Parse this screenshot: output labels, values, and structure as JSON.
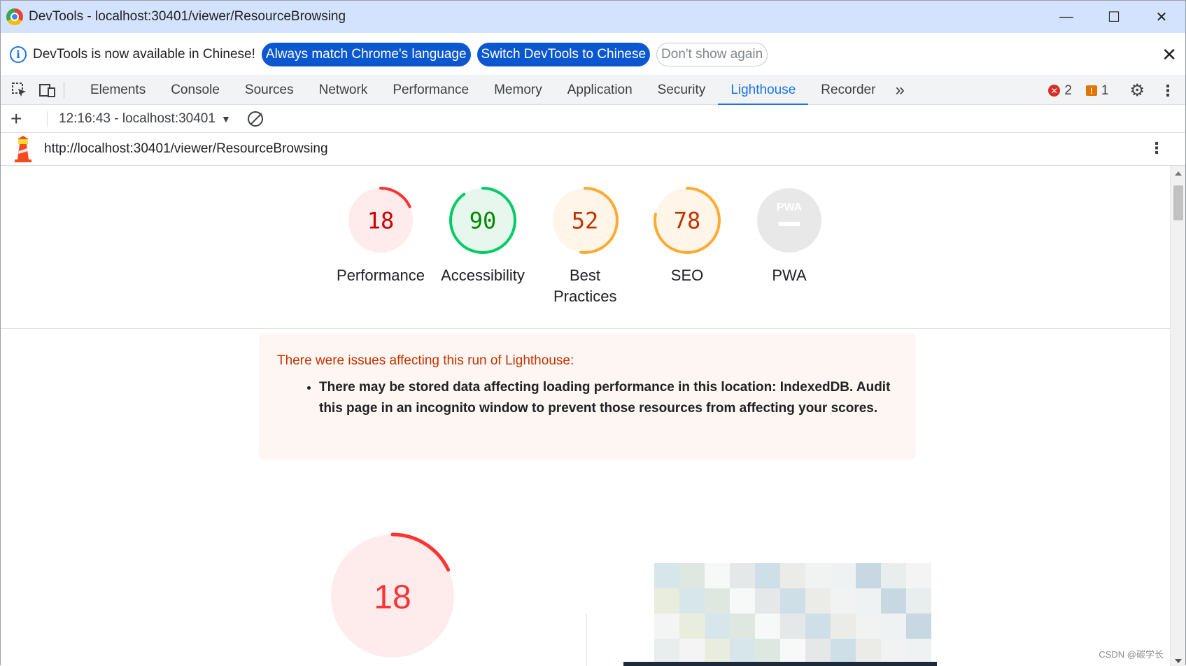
{
  "window": {
    "title": "DevTools - localhost:30401/viewer/ResourceBrowsing",
    "minimize_glyph": "—",
    "maximize_glyph": "☐",
    "close_glyph": "✕"
  },
  "infobar": {
    "message": "DevTools is now available in Chinese!",
    "btn_match": "Always match Chrome's language",
    "btn_switch": "Switch DevTools to Chinese",
    "btn_dismiss": "Don't show again",
    "close_glyph": "✕"
  },
  "tabs": {
    "items": [
      "Elements",
      "Console",
      "Sources",
      "Network",
      "Performance",
      "Memory",
      "Application",
      "Security",
      "Lighthouse",
      "Recorder"
    ],
    "active": "Lighthouse",
    "more_glyph": "»",
    "error_count": "2",
    "warning_count": "1"
  },
  "report": {
    "selected": "12:16:43 - localhost:30401",
    "url": "http://localhost:30401/viewer/ResourceBrowsing"
  },
  "scores": [
    {
      "label": "Performance",
      "value": 18,
      "display": "18",
      "color": "#f33",
      "text_color": "#c00",
      "bg": "#fdeceb"
    },
    {
      "label": "Accessibility",
      "value": 90,
      "display": "90",
      "color": "#0c6",
      "text_color": "#080",
      "bg": "#e7f7ed"
    },
    {
      "label": "Best Practices",
      "value": 52,
      "display": "52",
      "color": "#fa3",
      "text_color": "#c33300",
      "bg": "#fff5e9"
    },
    {
      "label": "SEO",
      "value": 78,
      "display": "78",
      "color": "#fa3",
      "text_color": "#c33300",
      "bg": "#fff5e9"
    },
    {
      "label": "PWA",
      "value": null,
      "display": "PWA",
      "color": "#ccc",
      "text_color": "#999",
      "bg": "#e8e8e8"
    }
  ],
  "warning": {
    "title": "There were issues affecting this run of Lighthouse:",
    "items": [
      "There may be stored data affecting loading performance in this location: IndexedDB. Audit this page in an incognito window to prevent those resources from affecting your scores."
    ]
  },
  "main_score": {
    "value": 18,
    "display": "18",
    "color": "#f33",
    "text_color": "#f33",
    "bg": "#fdeceb"
  },
  "watermark": "CSDN @碳学长"
}
